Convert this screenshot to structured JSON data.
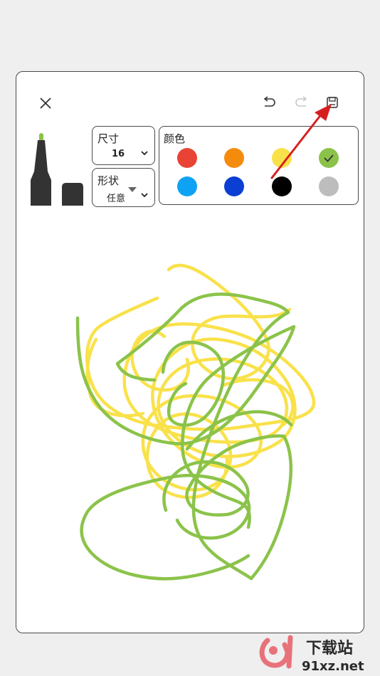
{
  "toolbar": {
    "size_label": "尺寸",
    "size_value": "16",
    "shape_label": "形状",
    "shape_value": "任意",
    "colors_label": "颜色"
  },
  "palette": {
    "colors": [
      "#e84335",
      "#f58b0d",
      "#f9e14a",
      "#8bc34a",
      "#0ea2f4",
      "#0b3ed3",
      "#000000",
      "#bdbdbd"
    ],
    "selected": "#8bc34a"
  },
  "icons": {
    "close": "close-icon",
    "undo": "undo-icon",
    "redo": "redo-icon",
    "save": "save-icon"
  },
  "watermark": {
    "brand": "下载站",
    "url": "91xz.net"
  }
}
